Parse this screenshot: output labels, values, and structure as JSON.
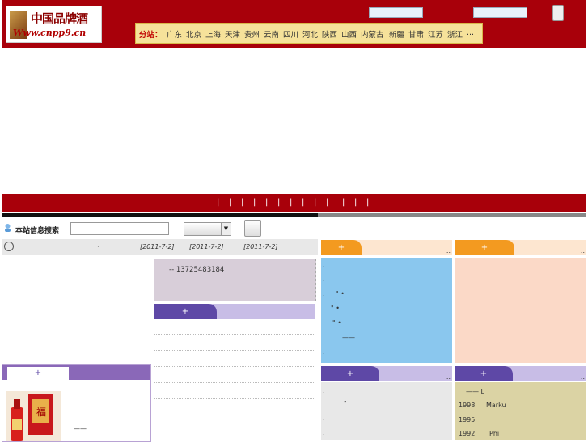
{
  "header": {
    "logo": {
      "title": "中国品牌酒",
      "site": "Www.cnpp9.cn"
    },
    "cities_label": "分站：",
    "cities": [
      "广东",
      "北京",
      "上海",
      "天津",
      "贵州",
      "云南",
      "四川",
      "河北",
      "陕西",
      "山西",
      "内蒙古",
      "新疆",
      "甘肃",
      "江苏",
      "浙江",
      "..."
    ]
  },
  "nav": {
    "separators": [
      "|",
      "|",
      "|",
      "|",
      "|",
      "|",
      "|",
      "|",
      "|",
      "|",
      "|",
      "|",
      "|"
    ]
  },
  "search": {
    "label": "本站信息搜索",
    "input_value": "",
    "select_value": ""
  },
  "ticker": {
    "dates": [
      "[2011-7-2]",
      "[2011-7-2]",
      "[2011-7-2]"
    ],
    "dots": [
      "·",
      "·",
      "·",
      "·"
    ]
  },
  "contact": {
    "text": "--  13725483184"
  },
  "tabs": {
    "plus": "+",
    "corner": ".."
  },
  "left_panel": {
    "plus": "+",
    "line": "——"
  },
  "khaki_list": [
    {
      "year": "",
      "text": "——     L"
    },
    {
      "year": "1998",
      "text": "Marku"
    },
    {
      "year": "1995",
      "text": ""
    },
    {
      "year": "1992",
      "text": "Phi"
    }
  ],
  "blue_lines": [
    ".",
    ".",
    ".",
    "\"  •",
    "\"   •",
    "\"  •",
    "——",
    "."
  ],
  "gray_marks": [
    ".",
    "\"",
    ".",
    "."
  ],
  "colors": {
    "header_red": "#a8000a",
    "tab_orange": "#f39a20",
    "tab_purple": "#5e48a6",
    "blue_box": "#8ac7ee"
  }
}
